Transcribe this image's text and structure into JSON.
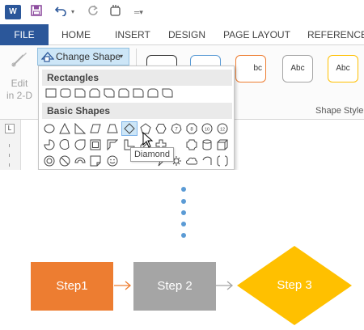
{
  "title_bar": {
    "app_icon": "word-icon",
    "app_label": "W",
    "save_icon": "floppy-disk-icon",
    "undo_icon": "undo-icon",
    "redo_icon": "redo-icon",
    "touch_icon": "touch-mode-icon",
    "customize_icon": "customize-qat-icon"
  },
  "tabs": [
    {
      "label": "FILE"
    },
    {
      "label": "HOME"
    },
    {
      "label": "INSERT"
    },
    {
      "label": "DESIGN"
    },
    {
      "label": "PAGE LAYOUT"
    },
    {
      "label": "REFERENCES"
    }
  ],
  "ribbon": {
    "edit_2d": {
      "line1": "Edit",
      "line2": "in 2-D",
      "icon": "edit-points-icon"
    },
    "change_shape": {
      "label": "Change Shape",
      "icon": "change-shape-icon",
      "caret": "▾"
    },
    "style_tiles": [
      {
        "label": "",
        "border": "#333333"
      },
      {
        "label": "",
        "border": "#5b9bd5"
      },
      {
        "label": "bc",
        "border": "#ed7d31"
      },
      {
        "label": "Abc",
        "border": "#a5a5a5"
      },
      {
        "label": "Abc",
        "border": "#ffc000"
      }
    ],
    "group_label": "Shape Style"
  },
  "dropdown": {
    "sections": [
      {
        "title": "Rectangles"
      },
      {
        "title": "Basic Shapes"
      }
    ],
    "rectangles": [
      "rectangle",
      "rounded-rectangle",
      "snip-single-corner",
      "snip-same-side",
      "snip-diagonal",
      "snip-round-single",
      "round-single-corner",
      "round-same-side",
      "round-diagonal"
    ],
    "basic_row1": [
      "oval",
      "isosceles-triangle",
      "right-triangle",
      "parallelogram",
      "trapezoid",
      "diamond",
      "pentagon",
      "hexagon",
      "heptagon",
      "octagon",
      "decagon",
      "dodecagon"
    ],
    "basic_row1_labels": {
      "heptagon": "7",
      "octagon": "8",
      "decagon": "10",
      "dodecagon": "12"
    },
    "basic_row2": [
      "pie",
      "chord",
      "teardrop",
      "frame",
      "half-frame",
      "l-shape",
      "diagonal-stripe",
      "cross",
      "plaque",
      "can",
      "cube"
    ],
    "basic_row3": [
      "donut",
      "no-symbol",
      "block-arc",
      "folded-corner",
      "smiley-face",
      "heart",
      "lightning-bolt",
      "sun",
      "moon",
      "cloud",
      "arc",
      "double-bracket"
    ],
    "hover_tooltip": "Diamond",
    "highlighted_shape": "diamond"
  },
  "left_ruler": {
    "marker": "L"
  },
  "flow": {
    "connector_dots": 5,
    "steps": [
      {
        "label": "Step1",
        "color": "#ed7d31",
        "shape": "rectangle"
      },
      {
        "label": "Step 2",
        "color": "#a5a5a5",
        "shape": "rectangle"
      },
      {
        "label": "Step 3",
        "color": "#ffc000",
        "shape": "diamond"
      }
    ],
    "arrow_colors": [
      "#ed7d31",
      "#a5a5a5"
    ]
  }
}
